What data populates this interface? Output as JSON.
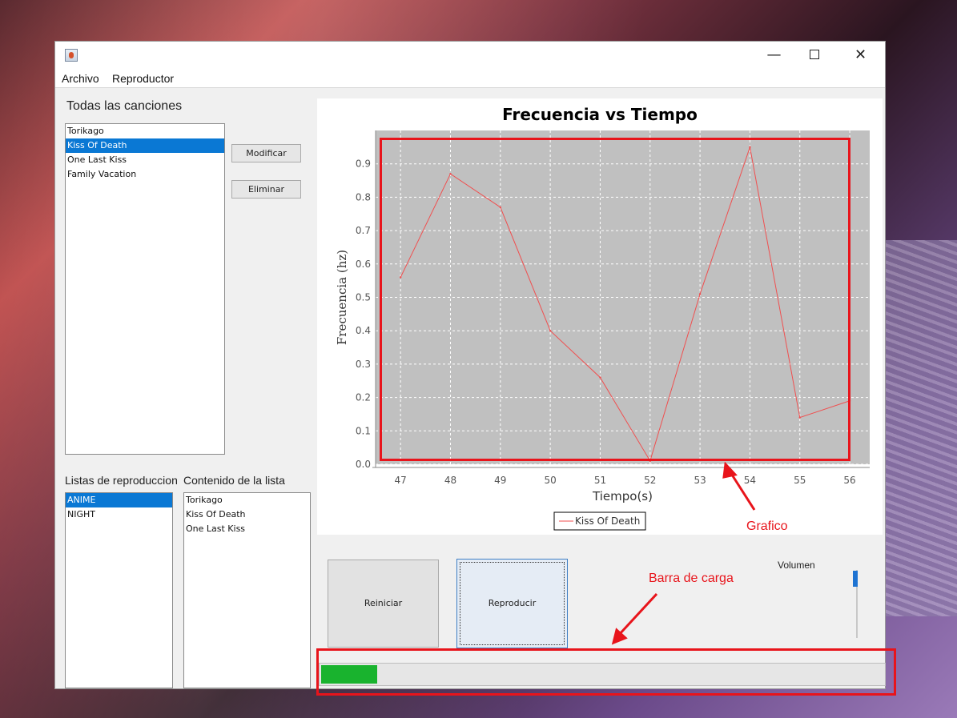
{
  "menu": {
    "items": [
      "Archivo",
      "Reproductor"
    ]
  },
  "songs": {
    "label": "Todas las canciones",
    "items": [
      "Torikago",
      "Kiss Of Death",
      "One Last Kiss",
      "Family Vacation"
    ],
    "selected_index": 1
  },
  "buttons": {
    "modify": "Modificar",
    "delete": "Eliminar",
    "reset": "Reiniciar",
    "play": "Reproducir"
  },
  "playlists": {
    "label": "Listas de reproduccion",
    "items": [
      "ANIME",
      "NIGHT"
    ],
    "selected_index": 0
  },
  "playlist_content": {
    "label": "Contenido de la lista",
    "items": [
      "Torikago",
      "Kiss Of Death",
      "One Last Kiss"
    ]
  },
  "volume": {
    "label": "Volumen",
    "level": 0.95
  },
  "progress": {
    "fraction": 0.1
  },
  "annotations": {
    "chart": "Grafico",
    "bar": "Barra de carga"
  },
  "colors": {
    "selection": "#0a78d4",
    "series": "#f04f4f",
    "plot_bg": "#c0c0c0",
    "progress": "#19b32e",
    "annotation": "#e8141b"
  },
  "chart_data": {
    "type": "line",
    "title": "Frecuencia vs Tiempo",
    "xlabel": "Tiempo(s)",
    "ylabel": "Frecuencia (hz)",
    "x": [
      47,
      48,
      49,
      50,
      51,
      52,
      53,
      54,
      55,
      56
    ],
    "series": [
      {
        "name": "Kiss Of Death",
        "values": [
          0.56,
          0.87,
          0.77,
          0.4,
          0.26,
          0.01,
          0.51,
          0.95,
          0.14,
          0.19
        ]
      }
    ],
    "xlim": [
      46.5,
      56.4
    ],
    "ylim": [
      0.0,
      1.0
    ],
    "xticks": [
      47,
      48,
      49,
      50,
      51,
      52,
      53,
      54,
      55,
      56
    ],
    "yticks": [
      "0.0",
      "0.1",
      "0.2",
      "0.3",
      "0.4",
      "0.5",
      "0.6",
      "0.7",
      "0.8",
      "0.9"
    ],
    "grid": true,
    "legend": "bottom"
  }
}
